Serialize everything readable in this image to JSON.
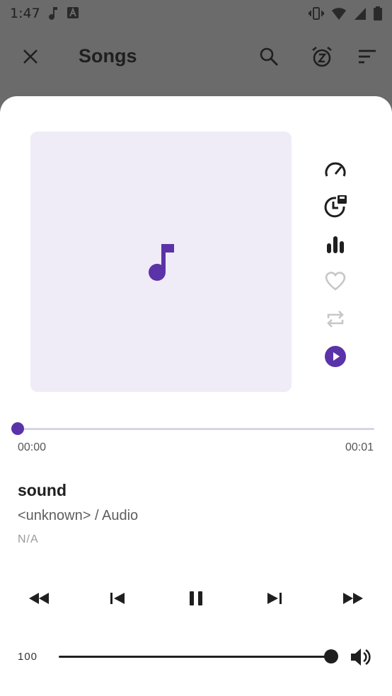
{
  "status_bar": {
    "time": "1:47",
    "left_icons": [
      "music-note-icon",
      "font-a-icon"
    ],
    "right_icons": [
      "vibrate-icon",
      "wifi-icon",
      "signal-icon",
      "battery-icon"
    ]
  },
  "app_bar": {
    "title": "Songs",
    "close_icon": "close-icon",
    "search_icon": "search-icon",
    "sleep_icon": "sleep-timer-icon",
    "sort_icon": "sort-icon"
  },
  "player": {
    "artwork_icon": "music-note-icon",
    "side_actions": [
      "speed-icon",
      "timer-save-icon",
      "equalizer-icon",
      "heart-icon",
      "repeat-icon",
      "play-circle-icon"
    ],
    "progress": {
      "current": "00:00",
      "total": "00:01",
      "fraction": 0
    },
    "song": {
      "title": "sound",
      "subtitle": "<unknown> / Audio",
      "extra": "N/A"
    },
    "controls": [
      "rewind-icon",
      "previous-icon",
      "pause-icon",
      "next-icon",
      "fast-forward-icon"
    ],
    "volume": {
      "value": "100",
      "fraction": 1.0
    }
  },
  "colors": {
    "accent": "#5b33a8",
    "artwork_bg": "#efebf7",
    "scrim": "#6b6b6b"
  }
}
